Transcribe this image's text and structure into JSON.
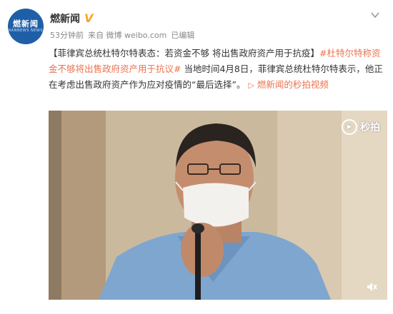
{
  "account": {
    "name": "燃新闻",
    "logo_text": "燃新闻",
    "logo_sub": "RANNEWS NEWS",
    "verified_badge": "V"
  },
  "meta": {
    "time": "53分钟前",
    "source": "来自 微博 weibo.com",
    "edited": "已编辑"
  },
  "post": {
    "headline": "【菲律宾总统杜特尔特表态：若资金不够 将出售政府资产用于抗疫】",
    "topic": "#杜特尔特称资金不够将出售政府资产用于抗议#",
    "body": " 当地时间4月8日，菲律宾总统杜特尔特表示，他正在考虑出售政府资产作为应对疫情的“最后选择”。",
    "link_text": "燃新闻的秒拍视频"
  },
  "video": {
    "watermark": "秒拍",
    "icons": [
      "chevron-down-icon",
      "play-watermark-icon",
      "mute-icon"
    ]
  },
  "colors": {
    "link": "#eb7350",
    "verified": "#f5a623",
    "avatar_bg": "#1f5fa8"
  }
}
